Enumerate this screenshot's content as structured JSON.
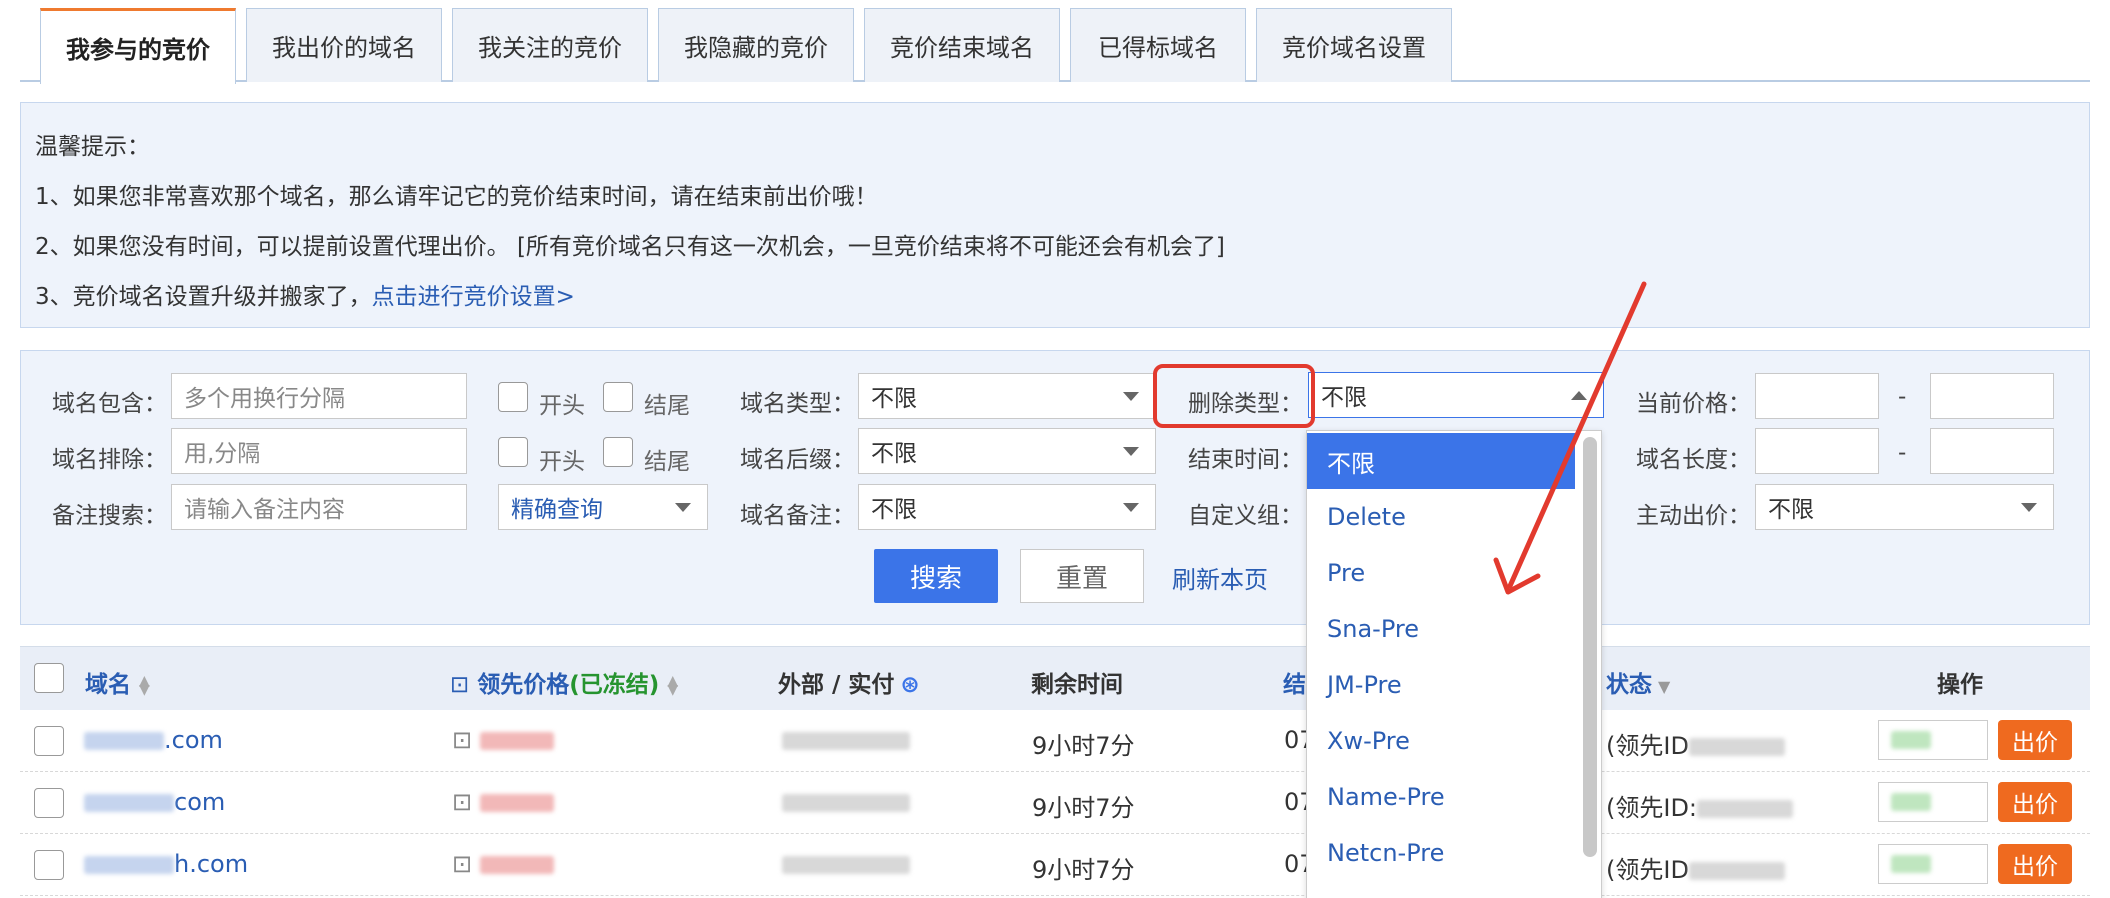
{
  "tabs": [
    "我参与的竞价",
    "我出价的域名",
    "我关注的竞价",
    "我隐藏的竞价",
    "竞价结束域名",
    "已得标域名",
    "竞价域名设置"
  ],
  "tips": {
    "title": "温馨提示：",
    "line1": "1、如果您非常喜欢那个域名，那么请牢记它的竞价结束时间，请在结束前出价哦！",
    "line2": "2、如果您没有时间，可以提前设置代理出价。 [所有竞价域名只有这一次机会，一旦竞价结束将不可能还会有机会了]",
    "line3_prefix": "3、竞价域名设置升级并搬家了，",
    "line3_link": "点击进行竞价设置>"
  },
  "filter": {
    "domain_contains_label": "域名包含：",
    "domain_contains_placeholder": "多个用换行分隔",
    "domain_exclude_label": "域名排除：",
    "domain_exclude_placeholder": "用,分隔",
    "note_search_label": "备注搜索：",
    "note_search_placeholder": "请输入备注内容",
    "starts_label": "开头",
    "ends_label": "结尾",
    "precise_query": "精确查询",
    "domain_type_label": "域名类型：",
    "domain_type_value": "不限",
    "domain_suffix_label": "域名后缀：",
    "domain_suffix_value": "不限",
    "domain_note_label": "域名备注：",
    "domain_note_value": "不限",
    "delete_type_label": "删除类型：",
    "delete_type_value": "不限",
    "end_time_label": "结束时间：",
    "custom_group_label": "自定义组：",
    "current_price_label": "当前价格：",
    "domain_length_label": "域名长度：",
    "active_bid_label": "主动出价：",
    "active_bid_value": "不限",
    "dash": "-",
    "search_button": "搜索",
    "reset_button": "重置",
    "refresh_link": "刷新本页"
  },
  "table": {
    "col_domain": "域名",
    "col_lead_price": "领先价格",
    "col_lead_price_frozen": "(已冻结)",
    "col_ext_actual": "外部 / 实付",
    "col_remaining": "剩余时间",
    "col_end": "结",
    "col_status": "状态",
    "col_action": "操作",
    "rows": [
      {
        "domain": ".com",
        "remaining": "9小时7分",
        "end": "07",
        "status": "(领先ID"
      },
      {
        "domain": "com",
        "remaining": "9小时7分",
        "end": "07",
        "status": "(领先ID:"
      },
      {
        "domain": "h.com",
        "remaining": "9小时7分",
        "end": "07",
        "status": "(领先ID"
      }
    ],
    "bid_button": "出价"
  },
  "dropdown": {
    "options": [
      "不限",
      "Delete",
      "Pre",
      "Sna-Pre",
      "JM-Pre",
      "Xw-Pre",
      "Name-Pre",
      "Netcn-Pre"
    ],
    "selected_index": 0
  },
  "colors": {
    "accent": "#3b74e8",
    "tab_active_border": "#ef7a2f",
    "bid_button": "#ef6a1f",
    "annotation_red": "#e23a2e",
    "link": "#2a5db3"
  }
}
